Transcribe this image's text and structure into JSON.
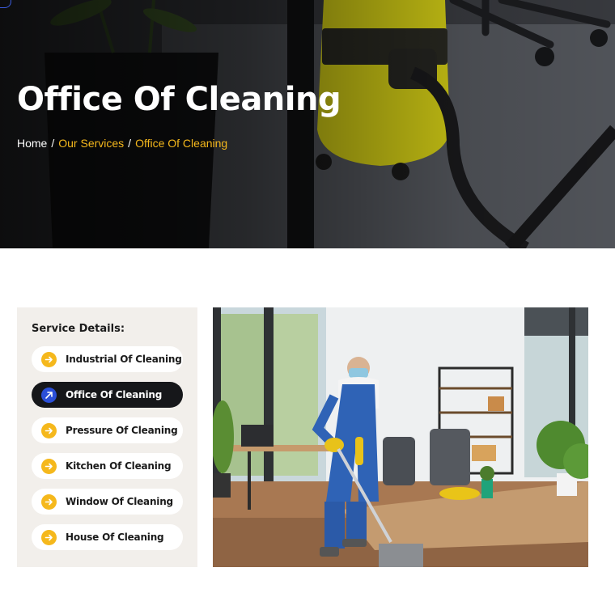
{
  "hero": {
    "title": "Office Of Cleaning",
    "breadcrumb": {
      "home": "Home",
      "separator": "/",
      "services": "Our Services",
      "current": "Office Of Cleaning"
    }
  },
  "colors": {
    "accent": "#f5b81c",
    "active_bg": "#16171a",
    "active_icon": "#2b4fd8",
    "sidebar_bg": "#f2efeb"
  },
  "sidebar": {
    "title": "Service Details:",
    "items": [
      {
        "label": "Industrial Of Cleaning",
        "icon": "arrow-right-icon",
        "active": false
      },
      {
        "label": "Office Of Cleaning",
        "icon": "arrow-right-icon",
        "active": true
      },
      {
        "label": "Pressure Of Cleaning",
        "icon": "arrow-right-icon",
        "active": false
      },
      {
        "label": "Kitchen Of Cleaning",
        "icon": "arrow-right-icon",
        "active": false
      },
      {
        "label": "Window Of Cleaning",
        "icon": "arrow-right-icon",
        "active": false
      },
      {
        "label": "House Of Cleaning",
        "icon": "arrow-right-icon",
        "active": false
      }
    ]
  }
}
